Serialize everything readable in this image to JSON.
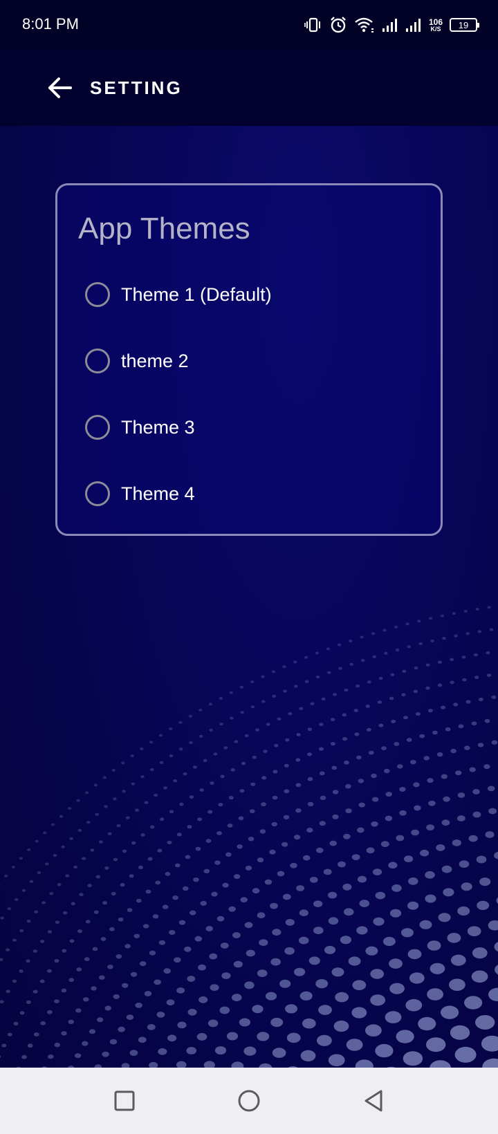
{
  "status_bar": {
    "time": "8:01 PM",
    "net_speed_value": "106",
    "net_speed_unit": "K/S",
    "battery_level": "19",
    "icons": [
      "vibrate-icon",
      "alarm-icon",
      "wifi-icon",
      "signal-icon",
      "signal-icon",
      "battery-icon"
    ]
  },
  "app_bar": {
    "back_icon": "arrow-left-icon",
    "title": "SETTING"
  },
  "themes_card": {
    "title": "App Themes",
    "options": [
      {
        "label": "Theme 1 (Default)",
        "selected": false
      },
      {
        "label": "theme 2",
        "selected": false
      },
      {
        "label": "Theme 3",
        "selected": false
      },
      {
        "label": "Theme 4",
        "selected": false
      }
    ]
  },
  "nav_bar": {
    "buttons": [
      "recents-square-icon",
      "home-circle-icon",
      "back-triangle-icon"
    ]
  },
  "colors": {
    "background": "#07044a",
    "status_bar": "#020126",
    "app_bar": "#03022f",
    "card_border": "#8c8bb8",
    "card_title": "#b4b3c8",
    "radio_border": "#8c8c98",
    "nav_bar": "#efeff2",
    "nav_icon": "#5a5a64"
  }
}
